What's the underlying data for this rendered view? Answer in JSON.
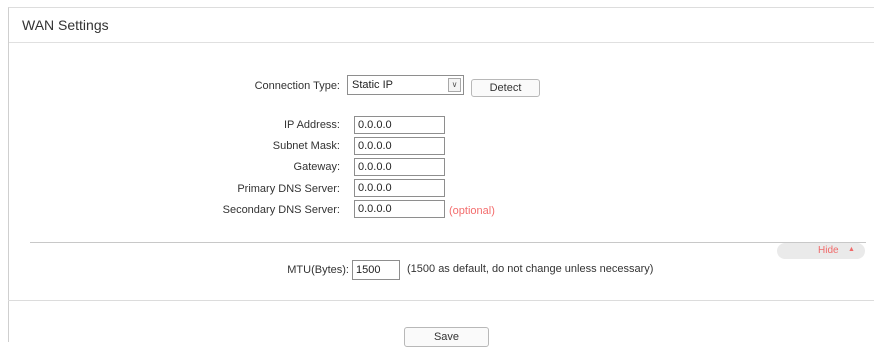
{
  "page": {
    "title": "WAN Settings"
  },
  "connection": {
    "label": "Connection Type:",
    "selected": "Static IP",
    "detect_label": "Detect"
  },
  "fields": {
    "ip_address": {
      "label": "IP Address:",
      "value": "0.0.0.0"
    },
    "subnet_mask": {
      "label": "Subnet Mask:",
      "value": "0.0.0.0"
    },
    "gateway": {
      "label": "Gateway:",
      "value": "0.0.0.0"
    },
    "primary_dns": {
      "label": "Primary DNS Server:",
      "value": "0.0.0.0"
    },
    "secondary_dns": {
      "label": "Secondary DNS Server:",
      "value": "0.0.0.0",
      "hint": "(optional)"
    }
  },
  "advanced": {
    "toggle_label": "Hide",
    "mtu_label": "MTU(Bytes):",
    "mtu_value": "1500",
    "mtu_note": "(1500 as default, do not change unless necessary)"
  },
  "footer": {
    "save_label": "Save"
  },
  "colors": {
    "hint": "#f36d6d",
    "toggle_text": "#f06a6a",
    "toggle_bg": "#eaeaea"
  },
  "icons": {
    "select_arrow": "chevron-down-icon",
    "toggle_caret": "caret-up-icon"
  }
}
